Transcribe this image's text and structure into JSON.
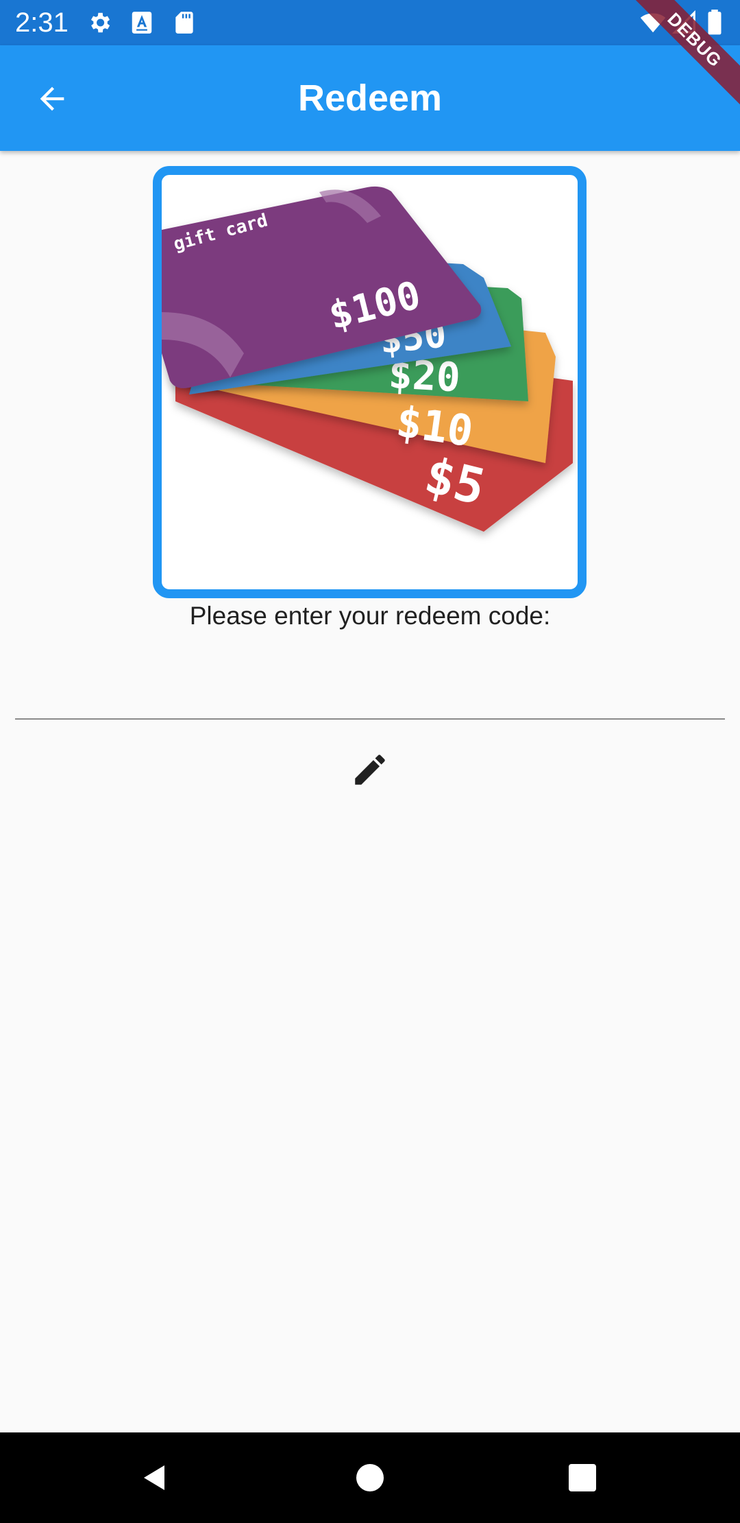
{
  "status_bar": {
    "time": "2:31",
    "left_icons": [
      "gear-icon",
      "text-a-icon",
      "sd-card-icon"
    ],
    "right_icons": [
      "wifi-icon",
      "cell-signal-icon",
      "battery-icon"
    ],
    "background_color": "#1976d2"
  },
  "app_bar": {
    "title": "Redeem",
    "back_icon": "arrow-back-icon",
    "background_color": "#2196f3"
  },
  "debug_banner": {
    "label": "DEBUG"
  },
  "gift_cards": {
    "image_label": "gift card",
    "cards": [
      {
        "value": "$100",
        "color": "#7b3a7e"
      },
      {
        "value": "$50",
        "color": "#3d84c6"
      },
      {
        "value": "$20",
        "color": "#3a9c5a"
      },
      {
        "value": "$10",
        "color": "#efa347"
      },
      {
        "value": "$5",
        "color": "#c8413f"
      }
    ],
    "frame_color": "#2196f3"
  },
  "redeem": {
    "prompt": "Please enter your redeem code:",
    "input_value": "",
    "edit_icon": "pencil-icon"
  },
  "nav_bar": {
    "buttons": [
      "back-triangle-icon",
      "home-circle-icon",
      "recents-square-icon"
    ]
  }
}
